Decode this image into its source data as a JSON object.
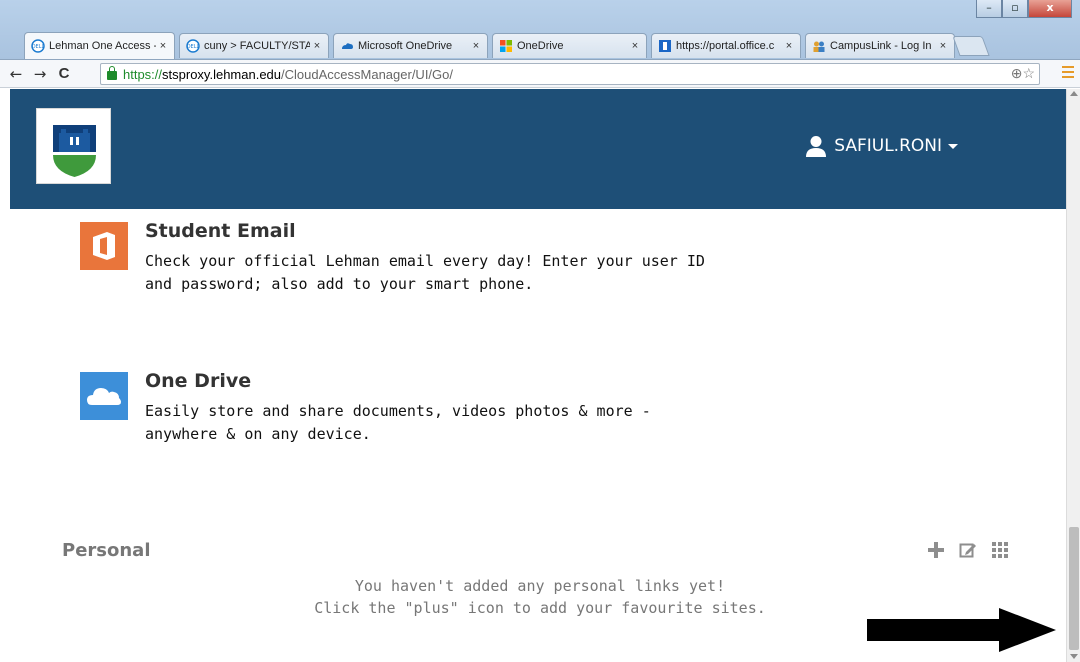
{
  "browser": {
    "tabs": [
      {
        "label": "Lehman One Access -",
        "icon": "dell-logo-icon",
        "active": true
      },
      {
        "label": "cuny > FACULTY/STA",
        "icon": "dell-logo-icon",
        "active": false
      },
      {
        "label": "Microsoft OneDrive",
        "icon": "onedrive-cloud-icon",
        "active": false
      },
      {
        "label": "OneDrive",
        "icon": "microsoft-logo-icon",
        "active": false
      },
      {
        "label": "https://portal.office.c",
        "icon": "office-icon",
        "active": false
      },
      {
        "label": "CampusLink - Log In",
        "icon": "campuslink-icon",
        "active": false
      }
    ],
    "tab_close": "×",
    "window_controls": {
      "minimize": "–",
      "maximize": "▫",
      "close": "x"
    },
    "nav": {
      "back": "←",
      "forward": "→",
      "reload": "C"
    },
    "url": {
      "scheme": "https://",
      "host": "stsproxy.lehman.edu",
      "path": "/CloudAccessManager/UI/Go/"
    },
    "omnibox_right": "⊕☆"
  },
  "header": {
    "logo_icon": "lehman-college-logo",
    "user_name": "SAFIUL.RONI",
    "user_icon": "user-icon"
  },
  "apps": [
    {
      "title": "Student Email",
      "description": "Check your official Lehman email every day! Enter your user ID and password; also add to your smart phone.",
      "icon": "office-icon",
      "color": "#e9753b"
    },
    {
      "title": "One Drive",
      "description": "Easily store and share documents, videos photos & more - anywhere & on any device.",
      "icon": "cloud-icon",
      "color": "#3d8fd9"
    }
  ],
  "personal": {
    "title": "Personal",
    "empty_line1": "You haven't added any personal links yet!",
    "empty_line2": "Click the \"plus\" icon to add your favourite sites.",
    "tools": [
      "plus-icon",
      "edit-icon",
      "grid-icon"
    ]
  },
  "colors": {
    "header_bg": "#1e4f77",
    "muted_text": "#777777",
    "secure_green": "#1e8b2b"
  }
}
